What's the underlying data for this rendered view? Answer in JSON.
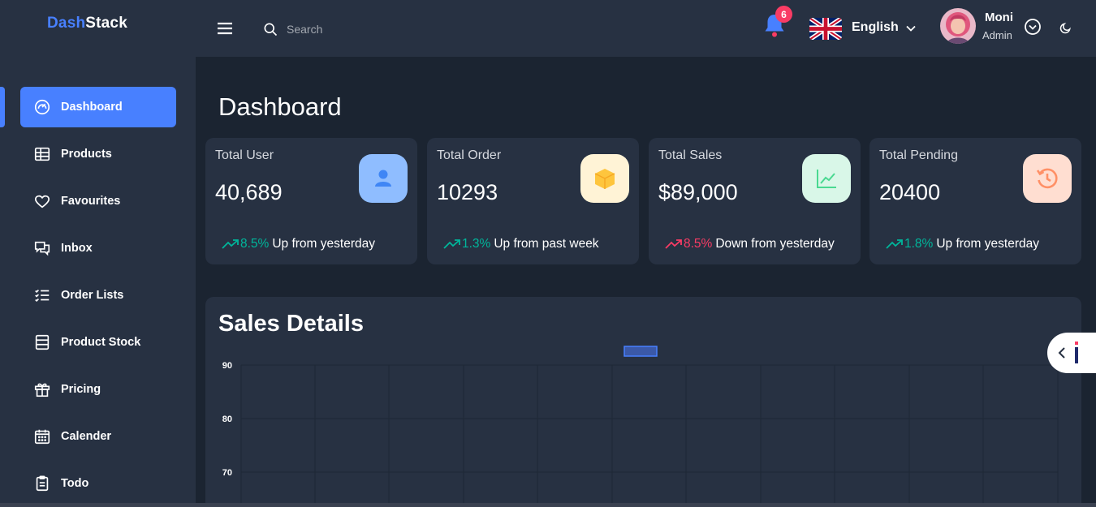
{
  "brand": {
    "part1": "Dash",
    "part2": "Stack"
  },
  "sidebar": {
    "items": [
      {
        "label": "Dashboard",
        "icon": "dashboard-icon",
        "active": true
      },
      {
        "label": "Products",
        "icon": "grid-icon"
      },
      {
        "label": "Favourites",
        "icon": "heart-icon"
      },
      {
        "label": "Inbox",
        "icon": "chat-icon"
      },
      {
        "label": "Order Lists",
        "icon": "checklist-icon"
      },
      {
        "label": "Product Stock",
        "icon": "stock-icon"
      },
      {
        "label": "Pricing",
        "icon": "gift-icon"
      },
      {
        "label": "Calender",
        "icon": "calendar-icon"
      },
      {
        "label": "Todo",
        "icon": "clipboard-icon"
      }
    ]
  },
  "header": {
    "search_placeholder": "Search",
    "notification_count": "6",
    "language": "English",
    "user": {
      "name": "Moni",
      "role": "Admin"
    }
  },
  "main": {
    "title": "Dashboard",
    "cards": [
      {
        "title": "Total User",
        "value": "40,689",
        "pct": "8.5%",
        "desc": "Up from yesterday",
        "trend": "up",
        "icon": "user-icon",
        "icon_bg": "#8fbdff",
        "icon_color": "#3f86f5"
      },
      {
        "title": "Total Order",
        "value": "10293",
        "pct": "1.3%",
        "desc": "Up from past week",
        "trend": "up",
        "icon": "box-icon",
        "icon_bg": "#fff3d6",
        "icon_color": "#fec53d"
      },
      {
        "title": "Total Sales",
        "value": "$89,000",
        "pct": "8.5%",
        "desc": "Down from yesterday",
        "trend": "down",
        "icon": "line-chart-icon",
        "icon_bg": "#d9f7e8",
        "icon_color": "#4ad991"
      },
      {
        "title": "Total Pending",
        "value": "20400",
        "pct": "1.8%",
        "desc": "Up from yesterday",
        "trend": "up",
        "icon": "history-icon",
        "icon_bg": "#ffded1",
        "icon_color": "#ff9066"
      }
    ],
    "sales": {
      "title": "Sales Details",
      "y_ticks": [
        "90",
        "80",
        "70"
      ]
    }
  },
  "colors": {
    "accent": "#4880ff",
    "up": "#00b69b",
    "down": "#f93c65",
    "panel": "#273142",
    "bg": "#1b2431"
  }
}
